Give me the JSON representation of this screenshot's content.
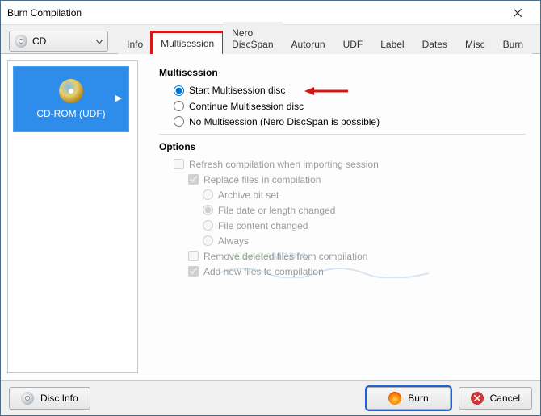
{
  "window": {
    "title": "Burn Compilation"
  },
  "mediaSelect": {
    "label": "CD"
  },
  "tabs": [
    {
      "label": "Info"
    },
    {
      "label": "Multisession"
    },
    {
      "label": "Nero DiscSpan"
    },
    {
      "label": "Autorun"
    },
    {
      "label": "UDF"
    },
    {
      "label": "Label"
    },
    {
      "label": "Dates"
    },
    {
      "label": "Misc"
    },
    {
      "label": "Burn"
    }
  ],
  "discType": {
    "label": "CD-ROM (UDF)"
  },
  "multisession": {
    "heading": "Multisession",
    "options": {
      "start": "Start Multisession disc",
      "continue": "Continue Multisession disc",
      "none": "No Multisession (Nero DiscSpan is possible)"
    }
  },
  "options": {
    "heading": "Options",
    "refresh": "Refresh compilation when importing session",
    "replace": "Replace files in compilation",
    "archive": "Archive bit set",
    "filedate": "File date or length changed",
    "content": "File content changed",
    "always": "Always",
    "remove": "Remove deleted files from compilation",
    "addnew": "Add new files to compilation"
  },
  "footer": {
    "discinfo": "Disc Info",
    "burn": "Burn",
    "cancel": "Cancel"
  },
  "watermark": {
    "part1": "NESABA",
    "part2": "MEDIA"
  }
}
